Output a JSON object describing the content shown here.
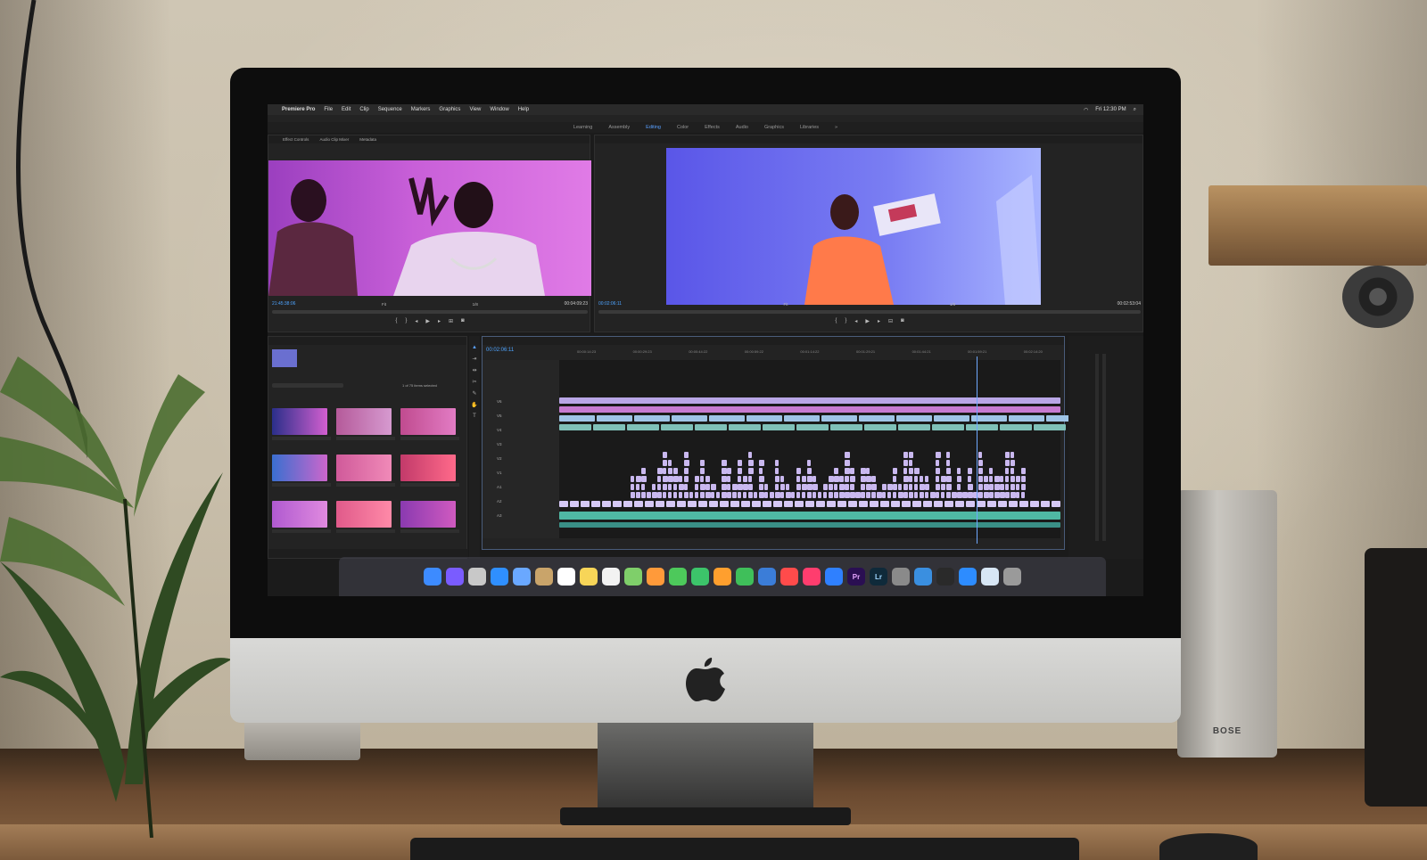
{
  "menubar": {
    "app_name": "Premiere Pro",
    "items": [
      "File",
      "Edit",
      "Clip",
      "Sequence",
      "Markers",
      "Graphics",
      "View",
      "Window",
      "Help"
    ],
    "clock": "Fri 12:30 PM"
  },
  "workspaces": {
    "items": [
      "Learning",
      "Assembly",
      "Editing",
      "Color",
      "Effects",
      "Audio",
      "Graphics",
      "Libraries"
    ],
    "active": "Editing"
  },
  "source_panel": {
    "tabs": [
      "Effect Controls",
      "Audio Clip Mixer",
      "Metadata"
    ],
    "timecode_current": "21:45:38:06",
    "fit": "Fit",
    "timecode_duration": "00:04:09:23",
    "resolution": "1/8"
  },
  "program_panel": {
    "timecode_current": "00:02:06:11",
    "fit": "Fit",
    "resolution": "1/8",
    "timecode_duration": "00:02:53:04"
  },
  "timeline": {
    "timecode": "00:02:06:11",
    "ruler": [
      "00:00:14:23",
      "00:00:29:23",
      "00:00:44:22",
      "00:00:59:22",
      "00:01:14:22",
      "00:01:29:21",
      "00:01:44:21",
      "00:01:59:21",
      "00:02:14:20"
    ],
    "track_labels": [
      "V6",
      "V5",
      "V4",
      "V3",
      "V2",
      "V1",
      "A1",
      "A2",
      "A3"
    ]
  },
  "project_panel": {
    "items_selected": "1 of 75 items selected"
  },
  "colors": {
    "source_bg": "#c85fd8",
    "program_bg": "#7a7ef3",
    "timecode": "#4ea4ff",
    "active_workspace": "#5aa0ff",
    "clip_purple": "#b9a6e6",
    "clip_teal": "#4fb8a4"
  },
  "dock": {
    "icons": [
      "finder-icon",
      "siri-icon",
      "launchpad-icon",
      "safari-icon",
      "mail-icon",
      "contacts-icon",
      "calendar-icon",
      "notes-icon",
      "reminders-icon",
      "maps-icon",
      "photos-icon",
      "messages-icon",
      "facetime-icon",
      "pages-icon",
      "numbers-icon",
      "keynote-icon",
      "news-icon",
      "music-icon",
      "app-store-icon",
      "premiere-icon",
      "lightroom-icon",
      "preferences-icon",
      "finder-folder-icon",
      "quicktime-icon",
      "zoom-icon",
      "preview-icon",
      "trash-icon"
    ],
    "premiere_label": "Pr",
    "lightroom_label": "Lr"
  },
  "speaker": {
    "brand": "BOSE"
  }
}
